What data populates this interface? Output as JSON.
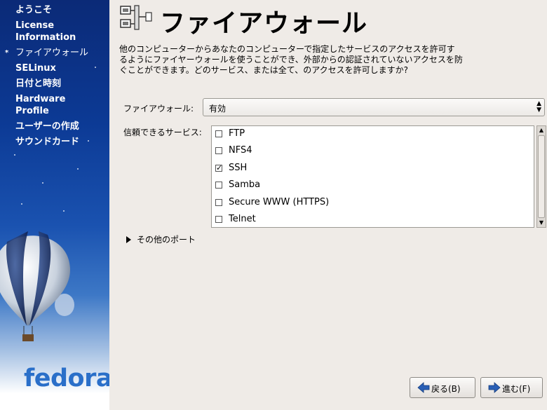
{
  "sidebar": {
    "items": [
      {
        "label": "ようこそ",
        "active": false
      },
      {
        "label": "License\nInformation",
        "active": false
      },
      {
        "label": "ファイアウォール",
        "active": true
      },
      {
        "label": "SELinux",
        "active": false
      },
      {
        "label": "日付と時刻",
        "active": false
      },
      {
        "label": "Hardware\nProfile",
        "active": false
      },
      {
        "label": "ユーザーの作成",
        "active": false
      },
      {
        "label": "サウンドカード",
        "active": false
      }
    ],
    "active_marker": "*",
    "logo_text": "fedora"
  },
  "header": {
    "title": "ファイアウォール",
    "icon": "network-firewall-icon"
  },
  "description": "他のコンピューターからあなたのコンピューターで指定したサービスのアクセスを許可するようにファイヤーウォールを使うことができ、外部からの認証されていないアクセスを防ぐことができます。どのサービス、または全て、のアクセスを許可しますか?",
  "firewall": {
    "label": "ファイアウォール:",
    "value": "有効"
  },
  "services": {
    "label": "信頼できるサービス:",
    "items": [
      {
        "name": "FTP",
        "checked": false
      },
      {
        "name": "NFS4",
        "checked": false
      },
      {
        "name": "SSH",
        "checked": true
      },
      {
        "name": "Samba",
        "checked": false
      },
      {
        "name": "Secure WWW (HTTPS)",
        "checked": false
      },
      {
        "name": "Telnet",
        "checked": false
      }
    ]
  },
  "other_ports": {
    "label": "その他のポート"
  },
  "buttons": {
    "back": "戻る(B)",
    "next": "進む(F)"
  },
  "colors": {
    "arrow_blue": "#2a5fb5",
    "sidebar_top": "#0b2a77",
    "logo_blue": "#2a6fc9"
  }
}
